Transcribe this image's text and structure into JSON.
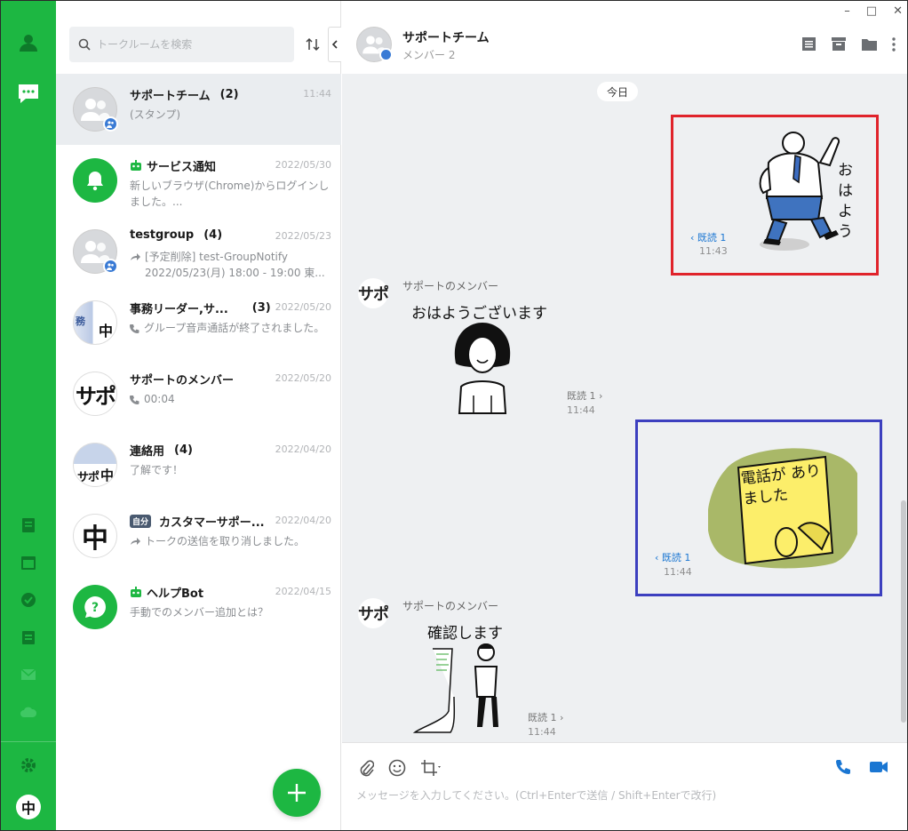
{
  "window": {
    "minimize": "–",
    "maximize": "□",
    "close": "✕"
  },
  "search": {
    "placeholder": "トークルームを検索"
  },
  "rooms": [
    {
      "name": "サポートチーム",
      "count": "(2)",
      "time": "11:44",
      "preview": "(スタンプ)"
    },
    {
      "name": "サービス通知",
      "time": "2022/05/30",
      "preview": "新しいブラウザ(Chrome)からログインしました。..."
    },
    {
      "name": "testgroup",
      "count": "(4)",
      "time": "2022/05/23",
      "preview1": "[予定削除] test-GroupNotify",
      "preview2": "2022/05/23(月) 18:00 - 19:00 東..."
    },
    {
      "name": "事務リーダー,サ...",
      "count": "(3)",
      "time": "2022/05/20",
      "preview": "グループ音声通話が終了されました。"
    },
    {
      "name": "サポートのメンバー",
      "time": "2022/05/20",
      "preview": "00:04",
      "avatar_text": "サポ"
    },
    {
      "name": "連絡用",
      "count": "(4)",
      "time": "2022/04/20",
      "preview": "了解です！"
    },
    {
      "name": "カスタマーサポー...",
      "badge": "自分",
      "time": "2022/04/20",
      "preview": "トークの送信を取り消しました。",
      "avatar_text": "中"
    },
    {
      "name": "ヘルプBot",
      "time": "2022/04/15",
      "preview": "手動でのメンバー追加とは？"
    }
  ],
  "chat": {
    "title": "サポートチーム",
    "subtitle": "メンバー 2",
    "date_label": "今日",
    "messages": [
      {
        "sticker_text": "おはよう",
        "read": "既読 1",
        "time": "11:43"
      },
      {
        "sender": "サポートのメンバー",
        "avatar_text": "サポ",
        "sticker_text": "おはようございます",
        "read": "既読 1",
        "time": "11:44"
      },
      {
        "sticker_text": "電話が ありました",
        "read": "既読 1",
        "time": "11:44"
      },
      {
        "sender": "サポートのメンバー",
        "avatar_text": "サポ",
        "sticker_text": "確認します",
        "read": "既読 1",
        "time": "11:44"
      }
    ],
    "input_placeholder": "メッセージを入力してください。(Ctrl+Enterで送信 / Shift+Enterで改行)"
  },
  "colors": {
    "brand": "#1db742",
    "highlight_red": "#e0232b",
    "highlight_blue": "#3c3fbf",
    "link_blue": "#1a76d2"
  },
  "icons": [
    "friends-icon",
    "chat-icon",
    "notes-icon",
    "calendar-icon",
    "tasks-icon",
    "schedule-icon",
    "mail-icon",
    "cloud-icon",
    "settings-icon",
    "search-icon",
    "sort-icon",
    "collapse-icon",
    "notes-header-icon",
    "album-icon",
    "folder-icon",
    "more-icon",
    "attach-icon",
    "emoji-icon",
    "crop-icon",
    "phone-icon",
    "video-icon",
    "add-icon"
  ]
}
